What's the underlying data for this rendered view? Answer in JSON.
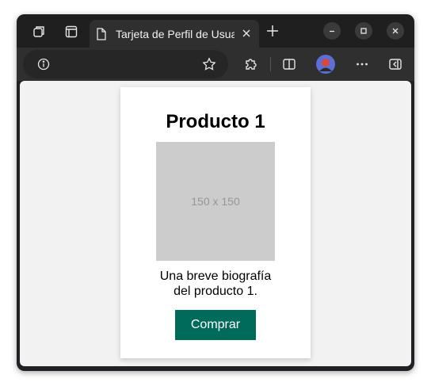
{
  "browser": {
    "tab": {
      "title": "Tarjeta de Perfil de Usuario"
    }
  },
  "card": {
    "title": "Producto 1",
    "image_placeholder": "150 x 150",
    "bio_line1": "Una breve biografía",
    "bio_line2": "del producto 1.",
    "button_label": "Comprar"
  },
  "colors": {
    "button_bg": "#006b5b",
    "page_bg": "#f2f2f2",
    "image_placeholder_bg": "#cccccc"
  }
}
